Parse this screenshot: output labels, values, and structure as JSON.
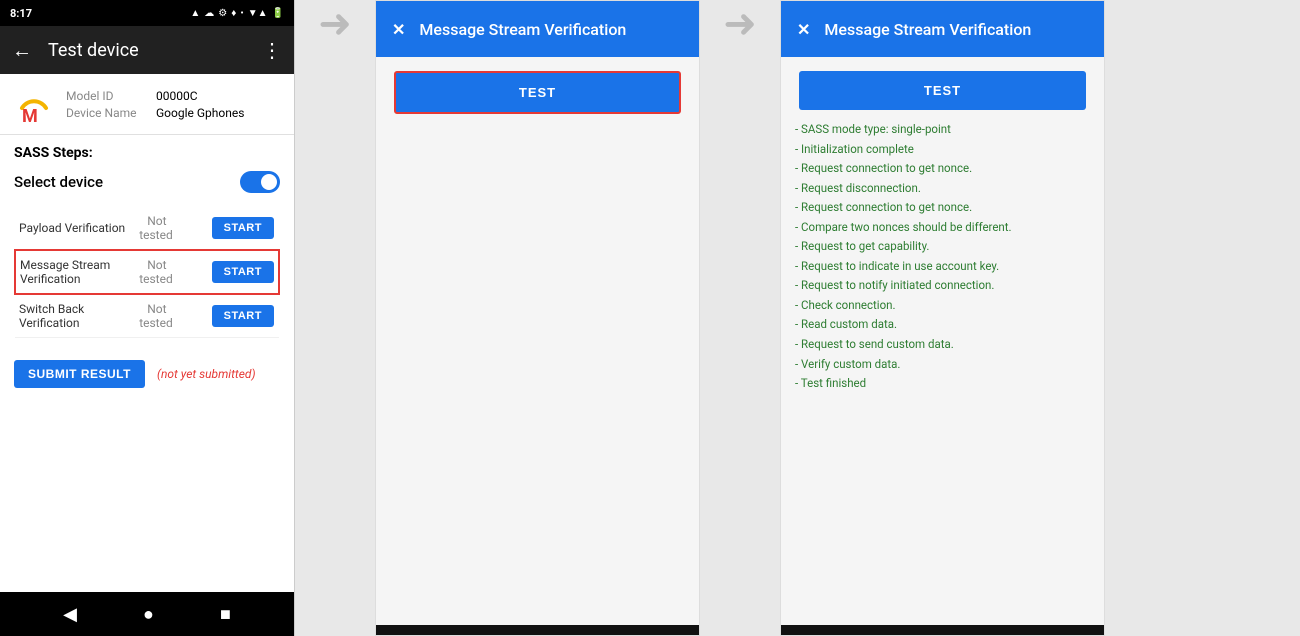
{
  "phone": {
    "status_bar": {
      "time": "8:17",
      "icons": "⊡ ☁ ⚙ ♦ •"
    },
    "top_bar": {
      "title": "Test device",
      "back": "←",
      "more": "⋮"
    },
    "device": {
      "model_label": "Model ID",
      "model_value": "00000C",
      "name_label": "Device Name",
      "name_value": "Google Gphones"
    },
    "sass": {
      "title": "SASS Steps:",
      "select_device": "Select device"
    },
    "steps": [
      {
        "label": "Payload Verification",
        "status": "Not tested",
        "btn": "START"
      },
      {
        "label": "Message Stream\nVerification",
        "status": "Not tested",
        "btn": "START",
        "highlight": true
      },
      {
        "label": "Switch Back Verification",
        "status": "Not tested",
        "btn": "START"
      }
    ],
    "submit": {
      "btn_label": "SUBMIT RESULT",
      "status": "(not yet submitted)"
    },
    "nav": [
      "◀",
      "●",
      "■"
    ]
  },
  "dialog1": {
    "title": "Message Stream Verification",
    "close": "✕",
    "test_btn": "TEST"
  },
  "dialog2": {
    "title": "Message Stream Verification",
    "close": "✕",
    "test_btn": "TEST",
    "results": [
      "- SASS mode type: single-point",
      "- Initialization complete",
      "- Request connection to get nonce.",
      "- Request disconnection.",
      "- Request connection to get nonce.",
      "- Compare two nonces should be different.",
      "- Request to get capability.",
      "- Request to indicate in use account key.",
      "- Request to notify initiated connection.",
      "- Check connection.",
      "- Read custom data.",
      "- Request to send custom data.",
      "- Verify custom data.",
      "- Test finished"
    ]
  }
}
